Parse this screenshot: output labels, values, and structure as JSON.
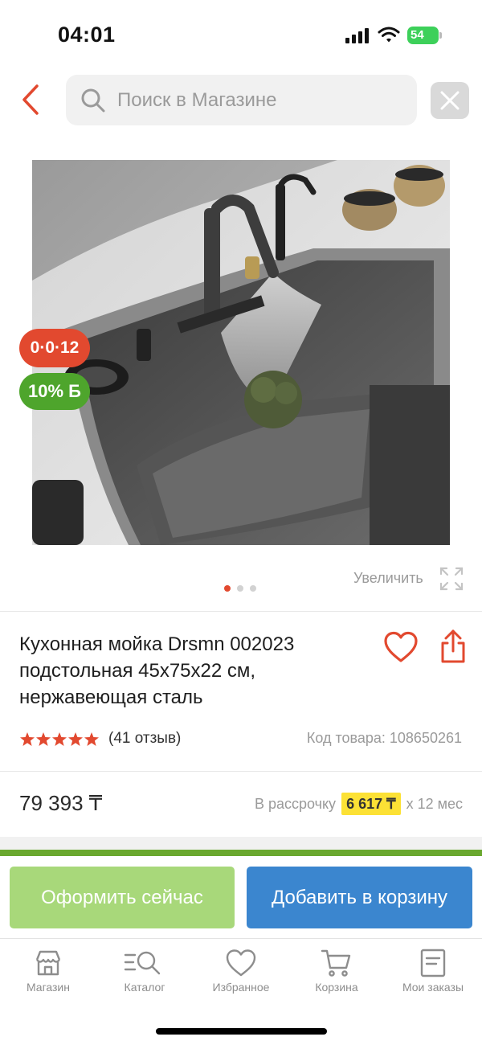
{
  "status_bar": {
    "time": "04:01",
    "battery": "54"
  },
  "search": {
    "placeholder": "Поиск в Магазине",
    "value": ""
  },
  "icons": {
    "back": "chevron-left-icon",
    "search": "search-icon",
    "close": "close-icon",
    "zoom": "expand-icon",
    "favorite": "heart-icon",
    "share": "share-icon"
  },
  "product": {
    "badges": {
      "timer": "0·0·12",
      "bonus": "10% Б"
    },
    "zoom_label": "Увеличить",
    "image_dots": {
      "count": 3,
      "active": 0
    },
    "title": "Кухонная мойка Drsmn 002023 подстольная 45x75x22 см, нержавеющая сталь",
    "rating": {
      "stars": 5,
      "reviews": "(41 отзыв)"
    },
    "code": "Код товара: 108650261",
    "price": "79 393 ₸",
    "installment": {
      "prefix": "В рассрочку",
      "amount": "6 617 ₸",
      "suffix": "x 12 мес"
    }
  },
  "actions": {
    "buy_now": "Оформить сейчас",
    "add_to_cart": "Добавить в корзину"
  },
  "bottom_nav": [
    {
      "label": "Магазин",
      "icon": "store-icon"
    },
    {
      "label": "Каталог",
      "icon": "catalog-search-icon"
    },
    {
      "label": "Избранное",
      "icon": "heart-icon"
    },
    {
      "label": "Корзина",
      "icon": "cart-icon"
    },
    {
      "label": "Мои заказы",
      "icon": "orders-icon"
    }
  ],
  "colors": {
    "accent_red": "#e2492f",
    "bonus_green": "#4ea52c",
    "buy_button": "#a8d87a",
    "cart_button": "#3b86cf",
    "installment_highlight": "#fce135"
  }
}
